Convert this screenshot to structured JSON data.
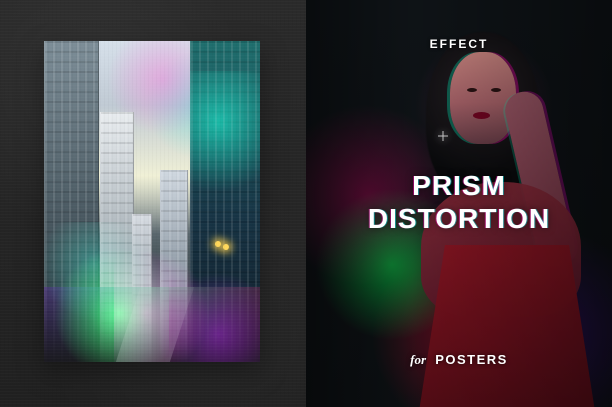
{
  "right_panel": {
    "eyebrow": "EFFECT",
    "headline_line_1": "PRISM",
    "headline_line_2": "DISTORTION",
    "footer_prefix": "for",
    "footer_label": "POSTERS"
  }
}
